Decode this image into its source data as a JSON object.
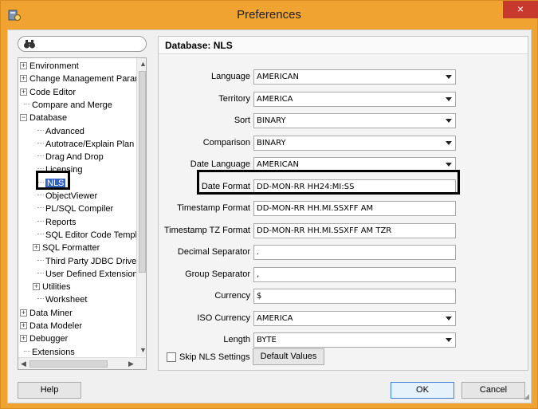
{
  "window": {
    "title": "Preferences",
    "close_glyph": "×"
  },
  "icons": {
    "app": "database-prefs-icon",
    "search": "binoculars-icon"
  },
  "tree": {
    "items": [
      {
        "label": "Environment",
        "expandable": true
      },
      {
        "label": "Change Management Paran",
        "expandable": true
      },
      {
        "label": "Code Editor",
        "expandable": true
      },
      {
        "label": "Compare and Merge",
        "expandable": false
      },
      {
        "label": "Database",
        "expandable": true,
        "expanded": true
      },
      {
        "label": "Advanced",
        "expandable": false
      },
      {
        "label": "Autotrace/Explain Plan",
        "expandable": false
      },
      {
        "label": "Drag And Drop",
        "expandable": false
      },
      {
        "label": "Licensing",
        "expandable": false
      },
      {
        "label": "NLS",
        "expandable": false,
        "selected": true
      },
      {
        "label": "ObjectViewer",
        "expandable": false
      },
      {
        "label": "PL/SQL Compiler",
        "expandable": false
      },
      {
        "label": "Reports",
        "expandable": false
      },
      {
        "label": "SQL Editor Code Templa",
        "expandable": false
      },
      {
        "label": "SQL Formatter",
        "expandable": true
      },
      {
        "label": "Third Party JDBC Driver",
        "expandable": false
      },
      {
        "label": "User Defined Extension",
        "expandable": false
      },
      {
        "label": "Utilities",
        "expandable": true
      },
      {
        "label": "Worksheet",
        "expandable": false
      },
      {
        "label": "Data Miner",
        "expandable": true
      },
      {
        "label": "Data Modeler",
        "expandable": true
      },
      {
        "label": "Debugger",
        "expandable": true
      },
      {
        "label": "Extensions",
        "expandable": false
      }
    ]
  },
  "panel": {
    "title": "Database: NLS",
    "rows": [
      {
        "label": "Language",
        "value": "AMERICAN",
        "type": "combo"
      },
      {
        "label": "Territory",
        "value": "AMERICA",
        "type": "combo"
      },
      {
        "label": "Sort",
        "value": "BINARY",
        "type": "combo"
      },
      {
        "label": "Comparison",
        "value": "BINARY",
        "type": "combo"
      },
      {
        "label": "Date Language",
        "value": "AMERICAN",
        "type": "combo"
      },
      {
        "label": "Date Format",
        "value": "DD-MON-RR HH24:MI:SS",
        "type": "field"
      },
      {
        "label": "Timestamp Format",
        "value": "DD-MON-RR HH.MI.SSXFF AM",
        "type": "field"
      },
      {
        "label": "Timestamp TZ Format",
        "value": "DD-MON-RR HH.MI.SSXFF AM TZR",
        "type": "field"
      },
      {
        "label": "Decimal Separator",
        "value": ".",
        "type": "field"
      },
      {
        "label": "Group Separator",
        "value": ",",
        "type": "field"
      },
      {
        "label": "Currency",
        "value": "$",
        "type": "field"
      },
      {
        "label": "ISO Currency",
        "value": "AMERICA",
        "type": "combo"
      },
      {
        "label": "Length",
        "value": "BYTE",
        "type": "combo"
      }
    ],
    "skip_label": "Skip NLS Settings",
    "default_values_label": "Default Values"
  },
  "footer": {
    "help": "Help",
    "ok": "OK",
    "cancel": "Cancel"
  },
  "colors": {
    "title_bar": "#f0a330",
    "close": "#c7392c",
    "selection": "#3163c5"
  }
}
